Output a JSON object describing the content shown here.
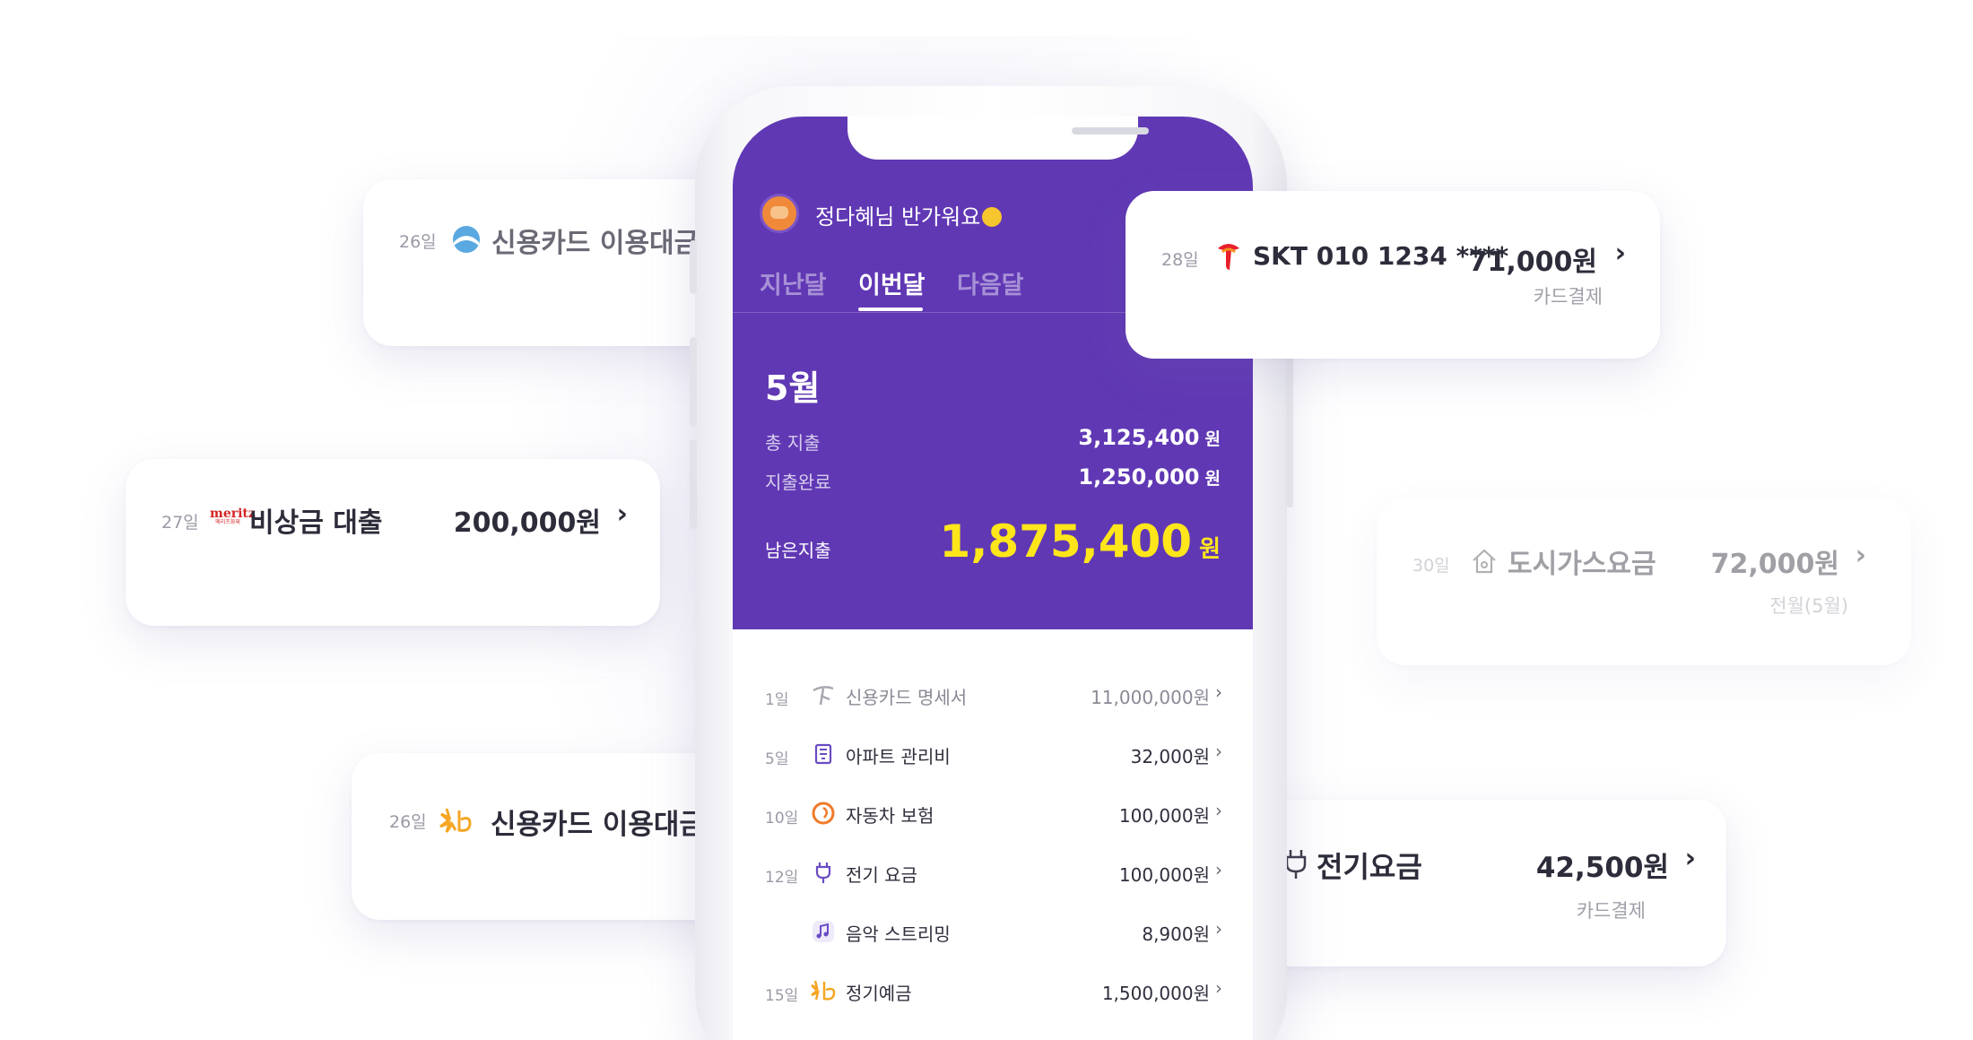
{
  "phone": {
    "greeting": "정다혜님 반가워요",
    "tabs": [
      {
        "label": "지난달",
        "active": false
      },
      {
        "label": "이번달",
        "active": true
      },
      {
        "label": "다음달",
        "active": false
      }
    ],
    "summary": {
      "month": "5월",
      "total_label": "총 지출",
      "total_value": "3,125,400",
      "done_label": "지출완료",
      "done_value": "1,250,000",
      "remain_label": "남은지출",
      "remain_value": "1,875,400",
      "currency": "원"
    },
    "list": [
      {
        "day": "1일",
        "name": "신용카드 명세서",
        "amount": "11,000,000원",
        "icon": "card-issuer-icon",
        "muted": true
      },
      {
        "day": "5일",
        "name": "아파트 관리비",
        "amount": "32,000원",
        "icon": "building-icon",
        "muted": false
      },
      {
        "day": "10일",
        "name": "자동차 보험",
        "amount": "100,000원",
        "icon": "insurance-icon",
        "muted": false
      },
      {
        "day": "12일",
        "name": "전기 요금",
        "amount": "100,000원",
        "icon": "plug-icon",
        "muted": false
      },
      {
        "day": "",
        "name": "음악 스트리밍",
        "amount": "8,900원",
        "icon": "music-note-icon",
        "muted": false
      },
      {
        "day": "15일",
        "name": "정기예금",
        "amount": "1,500,000원",
        "icon": "kb-star-icon",
        "muted": false
      }
    ]
  },
  "cards": {
    "card_26_top": {
      "day": "26일",
      "name": "신용카드 이용대금",
      "icon": "woori-icon"
    },
    "card_28": {
      "day": "28일",
      "name": "SKT 010 1234 ****",
      "amount": "71,000원",
      "sub": "카드결제",
      "icon": "skt-icon"
    },
    "card_27": {
      "day": "27일",
      "brand": "meritz",
      "brand_sub": "메리츠화재",
      "name": "비상금 대출",
      "amount": "200,000원",
      "icon": "meritz-icon"
    },
    "card_30": {
      "day": "30일",
      "name": "도시가스요금",
      "amount": "72,000원",
      "sub": "전월(5월)",
      "icon": "house-icon"
    },
    "card_26_kb": {
      "day": "26일",
      "name": "신용카드 이용대금",
      "icon": "kb-star-icon"
    },
    "card_elec": {
      "name": "전기요금",
      "amount": "42,500원",
      "sub": "카드결제",
      "icon": "plug-icon"
    }
  },
  "colors": {
    "brand_purple": "#6038b4",
    "highlight_yellow": "#ffe61b"
  }
}
